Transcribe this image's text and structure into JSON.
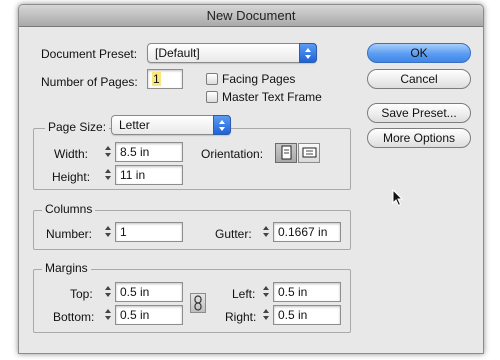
{
  "window": {
    "title": "New Document"
  },
  "preset": {
    "label": "Document Preset:",
    "value": "[Default]"
  },
  "pages": {
    "label": "Number of Pages:",
    "value": "1"
  },
  "options": {
    "facing_pages": "Facing Pages",
    "master_text_frame": "Master Text Frame"
  },
  "buttons": {
    "ok": "OK",
    "cancel": "Cancel",
    "save_preset": "Save Preset...",
    "more_options": "More Options"
  },
  "page_size": {
    "label": "Page Size:",
    "value": "Letter",
    "width_label": "Width:",
    "width": "8.5 in",
    "height_label": "Height:",
    "height": "11 in",
    "orientation_label": "Orientation:"
  },
  "columns": {
    "title": "Columns",
    "number_label": "Number:",
    "number": "1",
    "gutter_label": "Gutter:",
    "gutter": "0.1667 in"
  },
  "margins": {
    "title": "Margins",
    "top_label": "Top:",
    "top": "0.5 in",
    "bottom_label": "Bottom:",
    "bottom": "0.5 in",
    "left_label": "Left:",
    "left": "0.5 in",
    "right_label": "Right:",
    "right": "0.5 in"
  },
  "colors": {
    "accent": "#3f86ea",
    "highlight": "#fbe77c",
    "window_bg": "#e8e8e8"
  },
  "icons": {
    "portrait": "portrait-page-icon",
    "landscape": "landscape-page-icon",
    "link": "chain-link-icon",
    "cursor": "mouse-pointer-icon"
  }
}
